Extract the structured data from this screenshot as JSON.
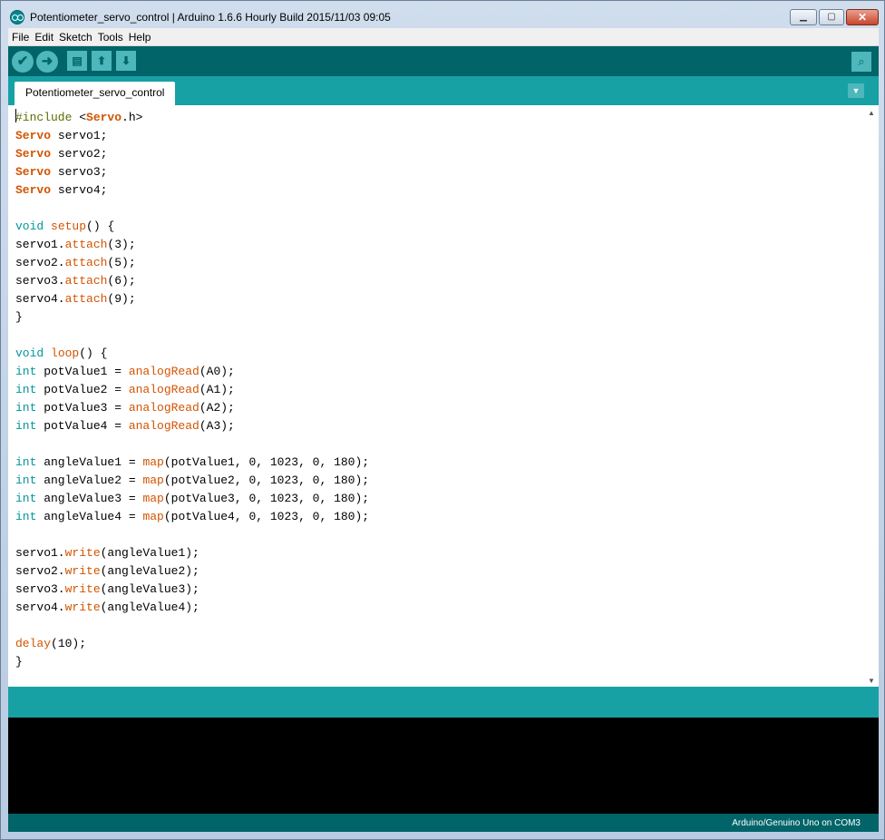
{
  "window": {
    "title": "Potentiometer_servo_control | Arduino 1.6.6 Hourly Build 2015/11/03 09:05",
    "minimize": "▁",
    "maximize": "▢",
    "close": "✕"
  },
  "menu": [
    "File",
    "Edit",
    "Sketch",
    "Tools",
    "Help"
  ],
  "toolbar": {
    "verify_icon": "check-icon",
    "upload_icon": "arrow-right-icon",
    "new_icon": "new-file-icon",
    "open_icon": "arrow-up-icon",
    "save_icon": "arrow-down-icon",
    "serial_icon": "magnifier-icon"
  },
  "tabs": [
    {
      "label": "Potentiometer_servo_control"
    }
  ],
  "code_lines": [
    [
      {
        "t": "#include ",
        "c": "k-pp"
      },
      {
        "t": "<",
        "c": ""
      },
      {
        "t": "Servo",
        "c": "k-class"
      },
      {
        "t": ".h>",
        "c": ""
      }
    ],
    [
      {
        "t": "Servo",
        "c": "k-class"
      },
      {
        "t": " servo1;",
        "c": ""
      }
    ],
    [
      {
        "t": "Servo",
        "c": "k-class"
      },
      {
        "t": " servo2;",
        "c": ""
      }
    ],
    [
      {
        "t": "Servo",
        "c": "k-class"
      },
      {
        "t": " servo3;",
        "c": ""
      }
    ],
    [
      {
        "t": "Servo",
        "c": "k-class"
      },
      {
        "t": " servo4;",
        "c": ""
      }
    ],
    [],
    [
      {
        "t": "void",
        "c": "k-type"
      },
      {
        "t": " ",
        "c": ""
      },
      {
        "t": "setup",
        "c": "k-fn"
      },
      {
        "t": "() {",
        "c": ""
      }
    ],
    [
      {
        "t": "servo1.",
        "c": ""
      },
      {
        "t": "attach",
        "c": "k-fn"
      },
      {
        "t": "(3);",
        "c": ""
      }
    ],
    [
      {
        "t": "servo2.",
        "c": ""
      },
      {
        "t": "attach",
        "c": "k-fn"
      },
      {
        "t": "(5);",
        "c": ""
      }
    ],
    [
      {
        "t": "servo3.",
        "c": ""
      },
      {
        "t": "attach",
        "c": "k-fn"
      },
      {
        "t": "(6);",
        "c": ""
      }
    ],
    [
      {
        "t": "servo4.",
        "c": ""
      },
      {
        "t": "attach",
        "c": "k-fn"
      },
      {
        "t": "(9);",
        "c": ""
      }
    ],
    [
      {
        "t": "}",
        "c": ""
      }
    ],
    [],
    [
      {
        "t": "void",
        "c": "k-type"
      },
      {
        "t": " ",
        "c": ""
      },
      {
        "t": "loop",
        "c": "k-fn"
      },
      {
        "t": "() {",
        "c": ""
      }
    ],
    [
      {
        "t": "int",
        "c": "k-type"
      },
      {
        "t": " potValue1 = ",
        "c": ""
      },
      {
        "t": "analogRead",
        "c": "k-fn"
      },
      {
        "t": "(A0);",
        "c": ""
      }
    ],
    [
      {
        "t": "int",
        "c": "k-type"
      },
      {
        "t": " potValue2 = ",
        "c": ""
      },
      {
        "t": "analogRead",
        "c": "k-fn"
      },
      {
        "t": "(A1);",
        "c": ""
      }
    ],
    [
      {
        "t": "int",
        "c": "k-type"
      },
      {
        "t": " potValue3 = ",
        "c": ""
      },
      {
        "t": "analogRead",
        "c": "k-fn"
      },
      {
        "t": "(A2);",
        "c": ""
      }
    ],
    [
      {
        "t": "int",
        "c": "k-type"
      },
      {
        "t": " potValue4 = ",
        "c": ""
      },
      {
        "t": "analogRead",
        "c": "k-fn"
      },
      {
        "t": "(A3);",
        "c": ""
      }
    ],
    [],
    [
      {
        "t": "int",
        "c": "k-type"
      },
      {
        "t": " angleValue1 = ",
        "c": ""
      },
      {
        "t": "map",
        "c": "k-fn"
      },
      {
        "t": "(potValue1, 0, 1023, 0, 180);",
        "c": ""
      }
    ],
    [
      {
        "t": "int",
        "c": "k-type"
      },
      {
        "t": " angleValue2 = ",
        "c": ""
      },
      {
        "t": "map",
        "c": "k-fn"
      },
      {
        "t": "(potValue2, 0, 1023, 0, 180);",
        "c": ""
      }
    ],
    [
      {
        "t": "int",
        "c": "k-type"
      },
      {
        "t": " angleValue3 = ",
        "c": ""
      },
      {
        "t": "map",
        "c": "k-fn"
      },
      {
        "t": "(potValue3, 0, 1023, 0, 180);",
        "c": ""
      }
    ],
    [
      {
        "t": "int",
        "c": "k-type"
      },
      {
        "t": " angleValue4 = ",
        "c": ""
      },
      {
        "t": "map",
        "c": "k-fn"
      },
      {
        "t": "(potValue4, 0, 1023, 0, 180);",
        "c": ""
      }
    ],
    [],
    [
      {
        "t": "servo1.",
        "c": ""
      },
      {
        "t": "write",
        "c": "k-fn"
      },
      {
        "t": "(angleValue1);",
        "c": ""
      }
    ],
    [
      {
        "t": "servo2.",
        "c": ""
      },
      {
        "t": "write",
        "c": "k-fn"
      },
      {
        "t": "(angleValue2);",
        "c": ""
      }
    ],
    [
      {
        "t": "servo3.",
        "c": ""
      },
      {
        "t": "write",
        "c": "k-fn"
      },
      {
        "t": "(angleValue3);",
        "c": ""
      }
    ],
    [
      {
        "t": "servo4.",
        "c": ""
      },
      {
        "t": "write",
        "c": "k-fn"
      },
      {
        "t": "(angleValue4);",
        "c": ""
      }
    ],
    [],
    [
      {
        "t": "delay",
        "c": "k-fn"
      },
      {
        "t": "(10);",
        "c": ""
      }
    ],
    [
      {
        "t": "}",
        "c": ""
      }
    ]
  ],
  "colors": {
    "toolbar": "#006468",
    "tabbar": "#17a1a5",
    "keyword_type": "#00979c",
    "keyword_fn": "#d35400",
    "preprocessor": "#5e6d03"
  },
  "footer": {
    "board": "Arduino/Genuino Uno on COM3"
  }
}
